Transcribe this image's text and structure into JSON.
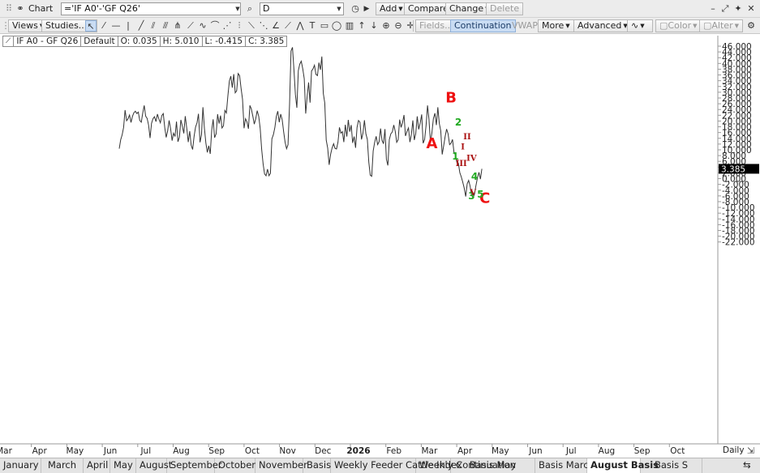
{
  "toolbar": {
    "window_title": "Chart",
    "symbol_value": "='IF A0'-'GF Q26'",
    "interval_value": "D",
    "add_label": "Add",
    "compare_label": "Compare",
    "change_label": "Change",
    "delete_label": "Delete",
    "views_label": "Views",
    "studies_label": "Studies...",
    "fields_label": "Fields...",
    "continuation_label": "Continuation",
    "vwap_label": "VWAP",
    "more_label": "More",
    "advanced_label": "Advanced",
    "color_label": "Color",
    "alter_label": "Alter"
  },
  "infobar": {
    "symbol": "IF A0 - GF Q26",
    "template": "Default",
    "open": "O: 0.035",
    "high": "H: 5.010",
    "low": "L: -0.415",
    "close": "C: 3.385"
  },
  "chart_data": {
    "type": "line",
    "ylim": [
      -23,
      47
    ],
    "y_ticks": [
      "46.000",
      "44.000",
      "42.000",
      "40.000",
      "38.000",
      "36.000",
      "34.000",
      "32.000",
      "30.000",
      "28.000",
      "26.000",
      "24.000",
      "22.000",
      "20.000",
      "18.000",
      "16.000",
      "14.000",
      "12.000",
      "10.000",
      "8.000",
      "6.000",
      "4.000",
      "2.000",
      "0.000",
      "-2.000",
      "-4.000",
      "-6.000",
      "-8.000",
      "-10.000",
      "-12.000",
      "-14.000",
      "-16.000",
      "-18.000",
      "-20.000",
      "-22.000"
    ],
    "last_value_label": "3.385",
    "x_ticks": [
      "Mar",
      "Apr",
      "May",
      "Jun",
      "Jul",
      "Aug",
      "Sep",
      "Oct",
      "Nov",
      "Dec",
      "2026",
      "Feb",
      "Mar",
      "Apr",
      "May",
      "Jun",
      "Jul",
      "Aug",
      "Sep",
      "Oct"
    ],
    "x_axis_label": "Daily",
    "series": [
      {
        "values": [
          10.4,
          13.5,
          15.2,
          17.8,
          23.8,
          20.1,
          20.8,
          22.1,
          19.5,
          21.6,
          22.9,
          23.4,
          22.6,
          23.1,
          20.2,
          19.6,
          22.8,
          25.4,
          21.7,
          20.9,
          18.6,
          14.1,
          19.2,
          20.8,
          21.5,
          19.8,
          22.4,
          20.7,
          19.4,
          21.9,
          22.6,
          17.8,
          14.3,
          16.6,
          20.2,
          17.4,
          13.2,
          15.8,
          14.6,
          19.8,
          12.8,
          14.4,
          20.4,
          18.2,
          15.7,
          21.7,
          17.4,
          12.7,
          16.5,
          11.6,
          10.1,
          14.7,
          17.9,
          19.4,
          22.5,
          12.6,
          15.2,
          24.8,
          17.6,
          12.4,
          9.1,
          11.4,
          8.6,
          16.8,
          20.6,
          14.2,
          15.6,
          22.4,
          19.1,
          21.9,
          17.6,
          18.3,
          23.7,
          22.8,
          28.6,
          33.9,
          35.6,
          31.6,
          36.3,
          29.8,
          30.5,
          36.5,
          35.8,
          31.4,
          27.6,
          17.5,
          20.8,
          19.7,
          17.3,
          25.4,
          24.2,
          21.7,
          18.9,
          20.8,
          23.6,
          21.6,
          17.4,
          10.2,
          5.1,
          1.6,
          1.0,
          3.3,
          1.0,
          1.8,
          13.8,
          15.3,
          17.8,
          21.6,
          23.4,
          19.6,
          22.4,
          20.5,
          16.3,
          12.6,
          10.4,
          11.8,
          25.8,
          44.3,
          45.6,
          37.8,
          29.2,
          24.6,
          37.5,
          39.8,
          40.8,
          38.1,
          34.7,
          22.6,
          28.6,
          33.4,
          26.4,
          37.4,
          38.1,
          39.4,
          36.2,
          35.8,
          40.3,
          37.8,
          42.4,
          29.6,
          26.3,
          13.4,
          10.6,
          4.8,
          8.4,
          10.6,
          12.1,
          10.5,
          10.3,
          12.7,
          17.8,
          15.8,
          16.3,
          12.7,
          18.7,
          14.6,
          20.4,
          16.3,
          18.6,
          12.4,
          14.6,
          10.7,
          17.8,
          20.2,
          19.6,
          13.6,
          15.8,
          20.3,
          15.6,
          13.6,
          5.7,
          1.2,
          0.8,
          9.6,
          12.6,
          14.7,
          11.8,
          12.8,
          17.4,
          13.3,
          12.1,
          17.2,
          6.7,
          4.6,
          13.6,
          15.6,
          16.2,
          18.6,
          16.4,
          12.6,
          13.5,
          20.5,
          17.8,
          19.5,
          22.1,
          14.8,
          16.4,
          17.6,
          12.7,
          15.4,
          20.2,
          13.4,
          15.7,
          21.6,
          17.1,
          19.2,
          22.3,
          12.3,
          13.6,
          18.4,
          25.4,
          20.6,
          12.4,
          15.9,
          20.8,
          22.7,
          18.6,
          24.8,
          19.2,
          16.6,
          8.4,
          11.4,
          14.6,
          17.2,
          15.6,
          11.8,
          12.3,
          13.6,
          9.2,
          8.2,
          5.6,
          5.4,
          2.1,
          0.6,
          -1.2,
          -3.4,
          -6.2,
          -1.8,
          -0.6,
          -2.6,
          -5.8,
          -6.6,
          -5.4,
          -2.4,
          0.2,
          2.2,
          -0.2,
          3.4
        ]
      }
    ],
    "annotations": [
      {
        "text": "B",
        "x_index": 226,
        "y": 26.4,
        "color": "#ee1111",
        "size": "large"
      },
      {
        "text": "A",
        "x_index": 213,
        "y": 10.6,
        "color": "#ee1111",
        "size": "large"
      },
      {
        "text": "C",
        "x_index": 249,
        "y": -8.4,
        "color": "#ee1111",
        "size": "large"
      },
      {
        "text": "2",
        "x_index": 231,
        "y": 18.4,
        "color": "#22aa22",
        "size": "small"
      },
      {
        "text": "1",
        "x_index": 229,
        "y": 6.6,
        "color": "#22aa22",
        "size": "small"
      },
      {
        "text": "4",
        "x_index": 242,
        "y": -0.4,
        "color": "#22aa22",
        "size": "small"
      },
      {
        "text": "3",
        "x_index": 240,
        "y": -7.2,
        "color": "#22aa22",
        "size": "small"
      },
      {
        "text": "5",
        "x_index": 246,
        "y": -6.6,
        "color": "#22aa22",
        "size": "small"
      },
      {
        "text": "II",
        "x_index": 237,
        "y": 13.6,
        "color": "#aa1111",
        "size": "roman"
      },
      {
        "text": "I",
        "x_index": 234,
        "y": 10.2,
        "color": "#aa1111",
        "size": "roman"
      },
      {
        "text": "III",
        "x_index": 233,
        "y": 4.3,
        "color": "#aa1111",
        "size": "roman"
      },
      {
        "text": "IV",
        "x_index": 240,
        "y": 6.2,
        "color": "#aa1111",
        "size": "roman"
      },
      {
        "text": "V",
        "x_index": 241,
        "y": -5.7,
        "color": "#aa1111",
        "size": "roman"
      }
    ]
  },
  "tabs": [
    "January",
    "March",
    "April",
    "May",
    "August",
    "September",
    "October",
    "November",
    "Basis",
    "Weekly Feeder Cattle Index",
    "Weekly Continuation",
    "Basis May",
    "Basis March",
    "August Basis",
    "Basis S"
  ],
  "active_tab": "August Basis"
}
